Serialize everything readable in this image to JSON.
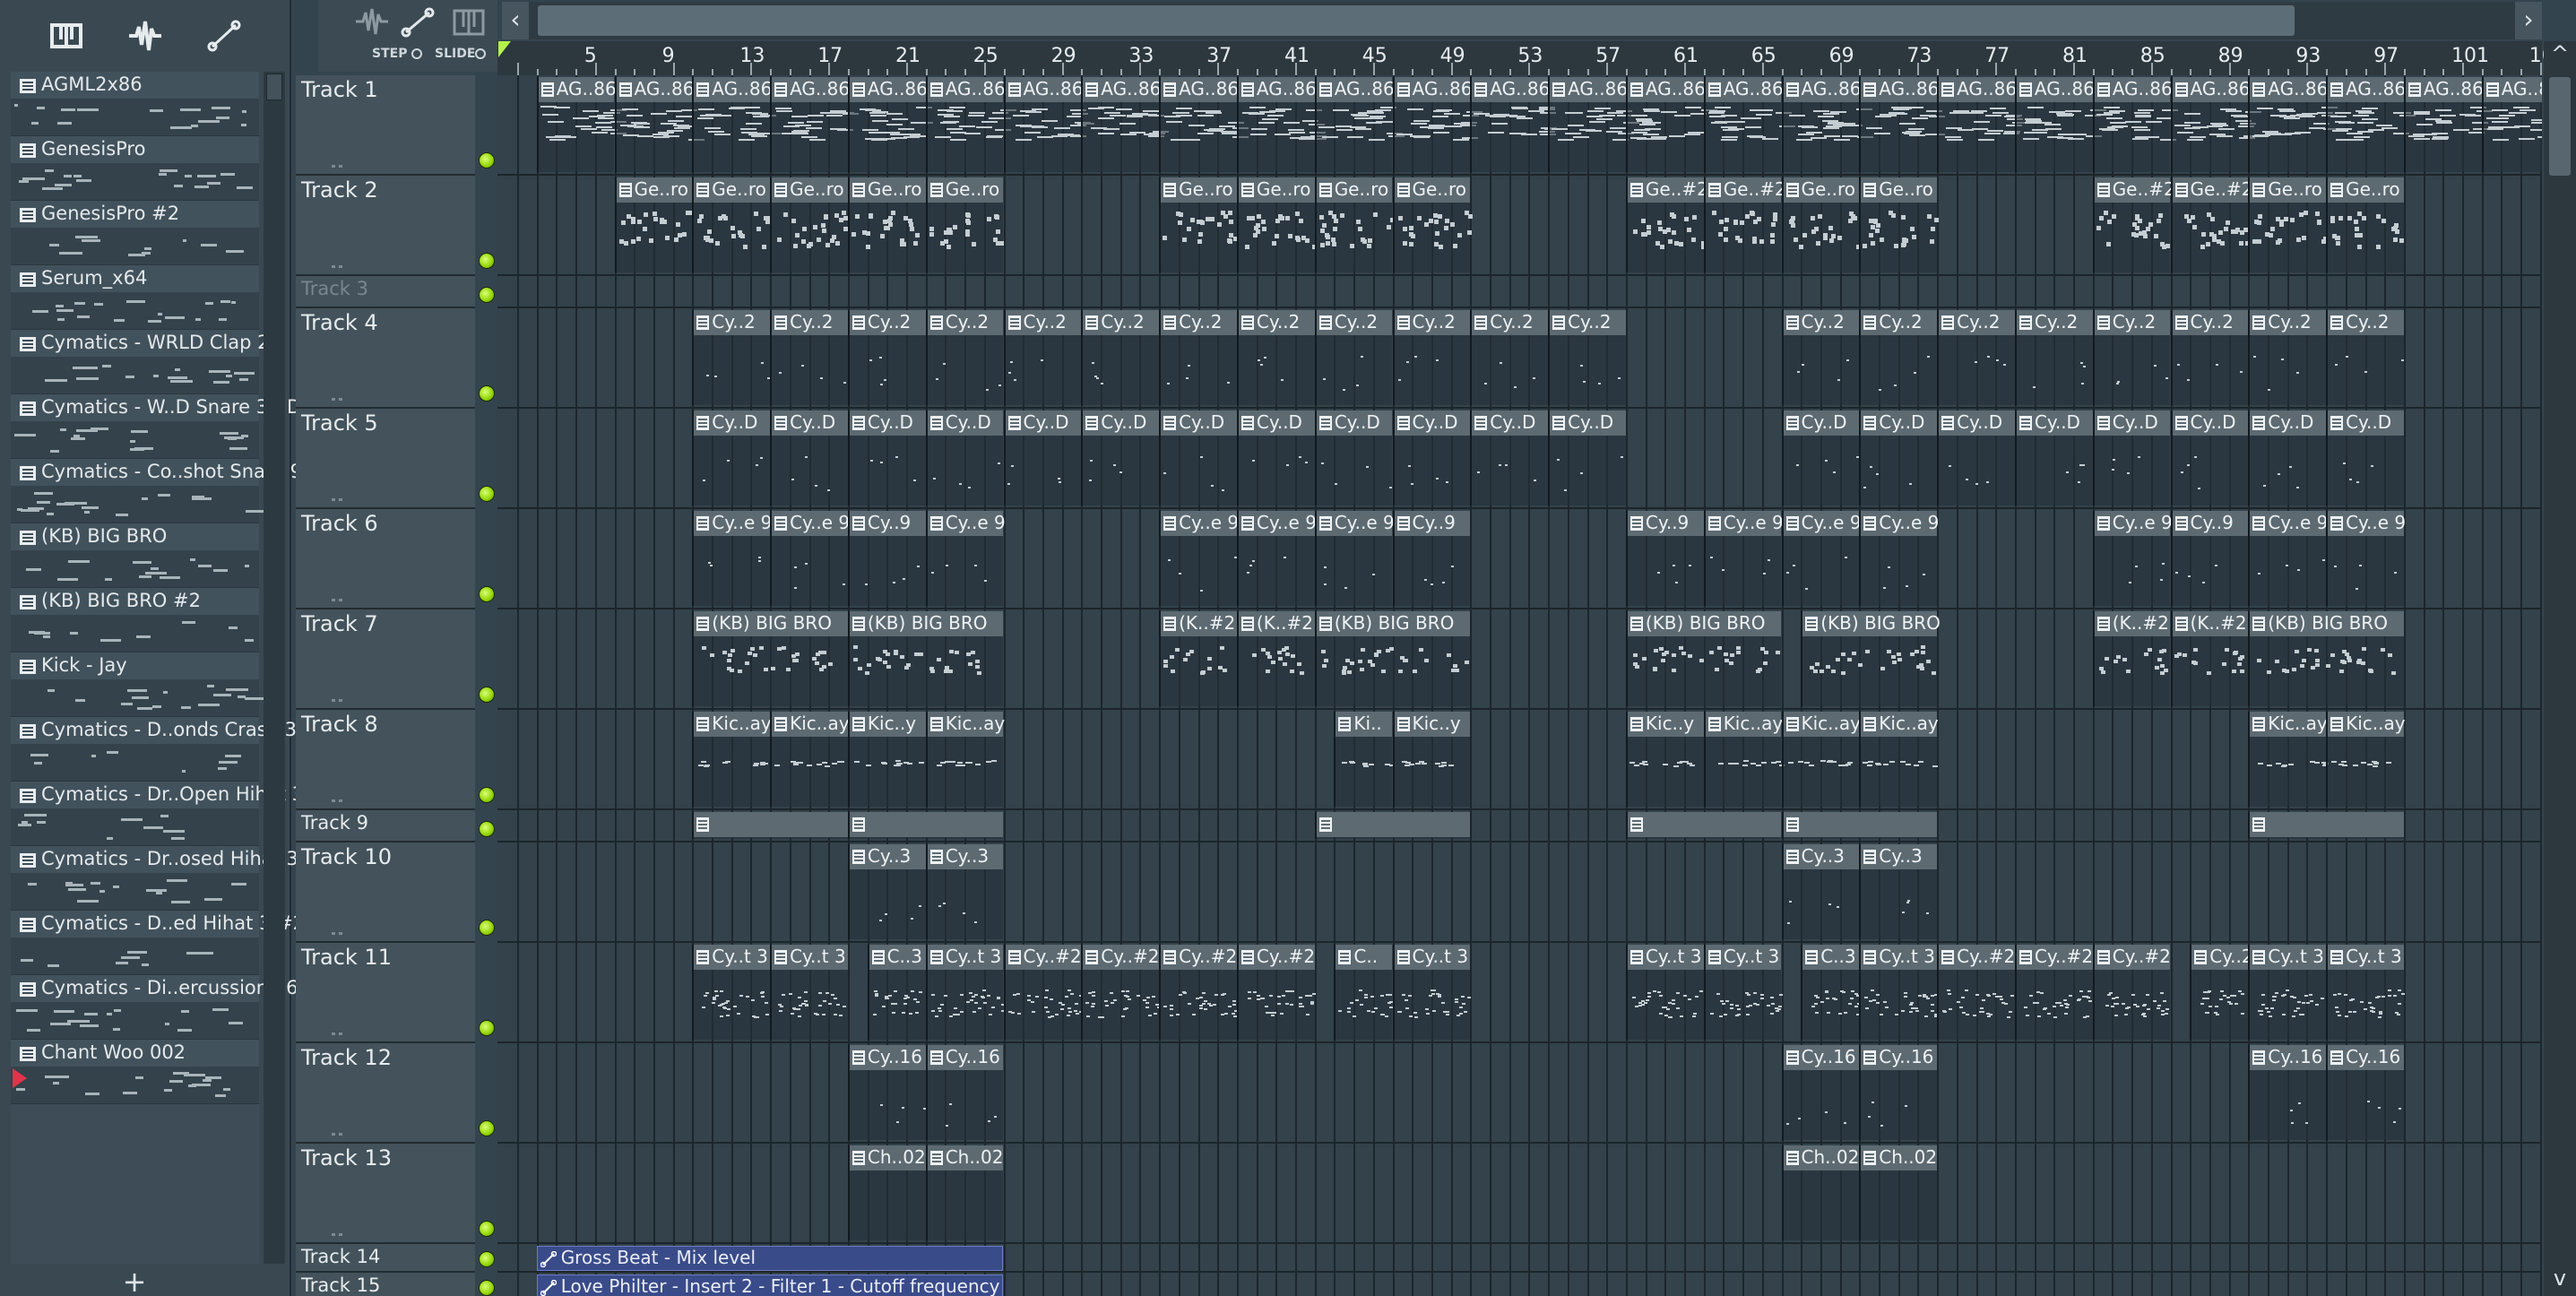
{
  "browser": {
    "toolbar": [
      {
        "name": "piano-roll-icon",
        "label": "Piano roll"
      },
      {
        "name": "audio-wave-icon",
        "label": "Audio"
      },
      {
        "name": "automation-icon",
        "label": "Automation"
      }
    ],
    "patterns": [
      "AGML2x86",
      "GenesisPro",
      "GenesisPro #2",
      "Serum_x64",
      "Cymatics - WRLD Clap 2",
      "Cymatics - W..D Snare 3 - D",
      "Cymatics - Co..shot Snare 9",
      "(KB) BIG BRO",
      "(KB) BIG BRO #2",
      "Kick - Jay",
      "Cymatics - D..onds Crash 3",
      "Cymatics - Dr..Open Hihat 3",
      "Cymatics - Dr..osed Hihat 3",
      "Cymatics - D..ed Hihat 3 #2",
      "Cymatics - Di..ercussion 16",
      "Chant Woo 002"
    ],
    "add_label": "+"
  },
  "top_controls": {
    "step": "STEP",
    "slide": "SLIDE"
  },
  "overview": {
    "left": "‹",
    "right": "›"
  },
  "ruler": [
    "5",
    "9",
    "13",
    "17",
    "21",
    "25",
    "29",
    "33",
    "37",
    "41",
    "45",
    "49",
    "53",
    "57",
    "61",
    "65",
    "69",
    "73",
    "77",
    "81",
    "85",
    "89",
    "93",
    "97",
    "101",
    "10"
  ],
  "tracks": [
    {
      "name": "Track 1"
    },
    {
      "name": "Track 2"
    },
    {
      "name": "Track 3"
    },
    {
      "name": "Track 4"
    },
    {
      "name": "Track 5"
    },
    {
      "name": "Track 6"
    },
    {
      "name": "Track 7"
    },
    {
      "name": "Track 8"
    },
    {
      "name": "Track 9"
    },
    {
      "name": "Track 10"
    },
    {
      "name": "Track 11"
    },
    {
      "name": "Track 12"
    },
    {
      "name": "Track 13"
    },
    {
      "name": "Track 14"
    },
    {
      "name": "Track 15"
    }
  ],
  "clips": {
    "track1": [
      "AG..86",
      "AG..86",
      "AG..86",
      "AG..86",
      "AG..86",
      "AG..86",
      "AG..86",
      "AG..86",
      "AG..86",
      "AG..86",
      "AG..86",
      "AG..86",
      "AG..86",
      "AG..86",
      "AG..86",
      "AG..86",
      "AG..86",
      "AG..86",
      "AG..86",
      "AG..86",
      "AG..86",
      "AG..86",
      "AG..86",
      "AG..86",
      "AG..86",
      "AG..86"
    ],
    "track2": [
      "Ge..ro",
      "Ge..ro",
      "Ge..ro",
      "Ge..ro",
      "Ge..ro",
      "Ge..ro",
      "Ge..ro",
      "Ge..ro",
      "Ge..ro",
      "Ge..#2",
      "Ge..#2",
      "Ge..ro",
      "Ge..ro",
      "Ge..#2",
      "Ge..#2",
      "Ge..ro",
      "Ge..ro"
    ],
    "track4": [
      "Cy..2",
      "Cy..2",
      "Cy..2",
      "Cy..2",
      "Cy..2",
      "Cy..2",
      "Cy..2",
      "Cy..2",
      "Cy..2",
      "Cy..2",
      "Cy..2",
      "Cy..2",
      "Cy..2",
      "Cy..2",
      "Cy..2",
      "Cy..2",
      "Cy..2",
      "Cy..2",
      "Cy..2",
      "Cy..2",
      "Cy..2"
    ],
    "track5": [
      "Cy..D",
      "Cy..D",
      "Cy..D",
      "Cy..D",
      "Cy..D",
      "Cy..D",
      "Cy..D",
      "Cy..D",
      "Cy..D",
      "Cy..D",
      "Cy..D",
      "Cy..D",
      "Cy..D",
      "Cy..D",
      "Cy..D",
      "Cy..D",
      "Cy..D",
      "Cy..D",
      "Cy..D",
      "Cy..D",
      "Cy..D"
    ],
    "track6": [
      "Cy..e 9",
      "Cy..e 9",
      "Cy..9",
      "Cy..e 9",
      "Cy..e 9",
      "Cy..e 9",
      "Cy..e 9",
      "Cy..9",
      "Cy..9",
      "Cy..e 9",
      "Cy..e 9",
      "Cy..e 9",
      "Cy..e 9",
      "Cy..9",
      "Cy..e 9",
      "Cy..e 9"
    ],
    "track7": [
      "(KB) BIG BRO",
      "(KB) BIG BRO",
      "(K..#2",
      "(K..#2",
      "(KB) BIG BRO",
      "(KB) BIG BRO",
      "(KB) BIG BRO",
      "(K..#2",
      "(K..#2",
      "(KB) BIG BRO"
    ],
    "track8": [
      "Kic..ay",
      "Kic..ay",
      "Kic..y",
      "Kic..ay",
      "Ki..",
      "Kic..y",
      "Kic..y",
      "Kic..ay",
      "Kic..ay",
      "Kic..ay",
      "Kic..ay",
      "Kic..ay"
    ],
    "track10": [
      "Cy..3",
      "Cy..3",
      "Cy..3",
      "Cy..3"
    ],
    "track11": [
      "Cy..t 3",
      "Cy..t 3",
      "C..3",
      "Cy..t 3",
      "Cy..#2",
      "Cy..#2",
      "Cy..#2",
      "Cy..#2",
      "C..",
      "Cy..t 3",
      "Cy..t 3",
      "Cy..t 3",
      "C..3",
      "Cy..t 3",
      "Cy..#2",
      "Cy..#2",
      "Cy..#2",
      "Cy..2",
      "Cy..t 3",
      "Cy..t 3"
    ],
    "track12": [
      "Cy..16",
      "Cy..16",
      "Cy..16",
      "Cy..16",
      "Cy..16",
      "Cy..16"
    ],
    "track13": [
      "Ch..02",
      "Ch..02",
      "Ch..02",
      "Ch..02"
    ],
    "track14": "Gross Beat - Mix level",
    "track15": "Love Philter - Insert 2 - Filter 1 - Cutoff frequency"
  },
  "colors": {
    "led": "#92d400",
    "automation": "#3a4b8a",
    "clip_header": "#5d6a72",
    "marker": "#e2334c"
  }
}
